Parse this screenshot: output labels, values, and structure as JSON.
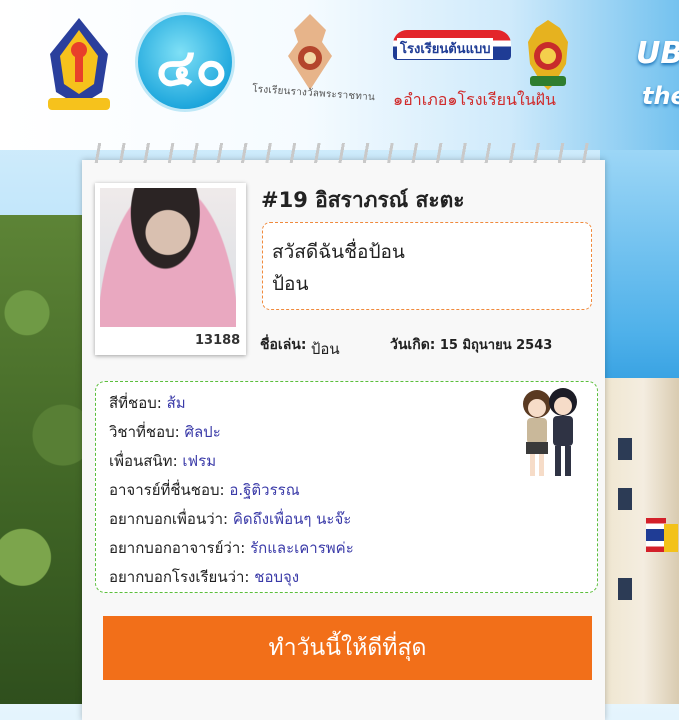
{
  "header": {
    "logo3_caption": "โรงเรียนรางวัลพระราชทาน",
    "dream_top": "โรงเรียนต้นแบบ",
    "dream_bottom": "๑อำเภอ๑โรงเรียนในฝัน",
    "brand_line1": "UB",
    "brand_line2": "the"
  },
  "profile": {
    "number_name": "#19 อิสราภรณ์ สะตะ",
    "photo_id": "13188",
    "greeting_line1": "สวัสดีฉันชื่อป้อน",
    "greeting_line2": "ป้อน",
    "nickname_label": "ชื่อเล่น:",
    "nickname": "ป้อน",
    "birthday_label": "วันเกิด:",
    "birthday": "15 มิถุนายน 2543"
  },
  "favorites": [
    {
      "label": "สีที่ชอบ:",
      "value": "ส้ม"
    },
    {
      "label": "วิชาที่ชอบ:",
      "value": "ศิลปะ"
    },
    {
      "label": "เพื่อนสนิท:",
      "value": "เฟรม"
    },
    {
      "label": "อาจารย์ที่ชื่นชอบ:",
      "value": "อ.ฐิติวรรณ"
    },
    {
      "label": "อยากบอกเพื่อนว่า:",
      "value": "คิดถึงเพื่อนๆ นะจ๊ะ"
    },
    {
      "label": "อยากบอกอาจารย์ว่า:",
      "value": "รักและเคารพค่ะ"
    },
    {
      "label": "อยากบอกโรงเรียนว่า:",
      "value": "ชอบจุง"
    }
  ],
  "cta_label": "ทำวันนี้ให้ดีที่สุด",
  "colors": {
    "accent": "#f26f19",
    "greet_border": "#f08a3c",
    "fav_border": "#5bbf3c",
    "value_text": "#3a3aa8"
  }
}
